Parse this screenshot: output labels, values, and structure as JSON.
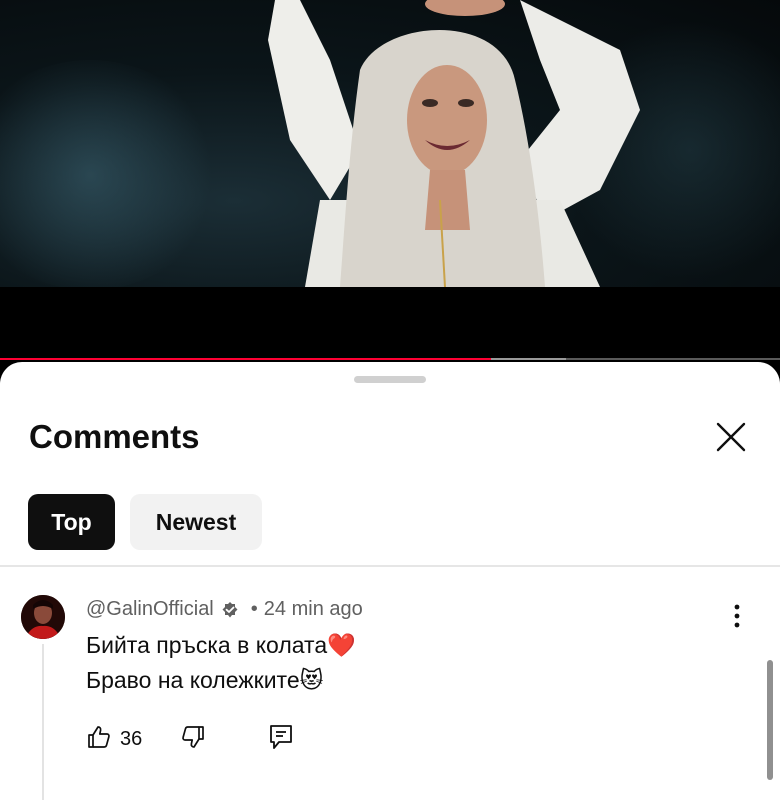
{
  "video": {
    "progress_fraction": 0.63,
    "buffer_fraction": 0.725,
    "accent_color": "#ff0033"
  },
  "comments_panel": {
    "title": "Comments",
    "close_icon": "close-icon",
    "filters": [
      {
        "label": "Top",
        "selected": true
      },
      {
        "label": "Newest",
        "selected": false
      }
    ]
  },
  "comment": {
    "author": "@GalinOfficial",
    "verified_icon": "verified-icon",
    "separator": "•",
    "time": "24 min ago",
    "text_line_1": "Бийта пръска в колата",
    "emoji_1": "❤️",
    "text_line_2": "Браво на колежките",
    "emoji_2": "😻",
    "likes": "36",
    "icons": {
      "like": "thumbs-up-icon",
      "dislike": "thumbs-down-icon",
      "reply": "reply-icon",
      "more": "more-vert-icon"
    }
  }
}
